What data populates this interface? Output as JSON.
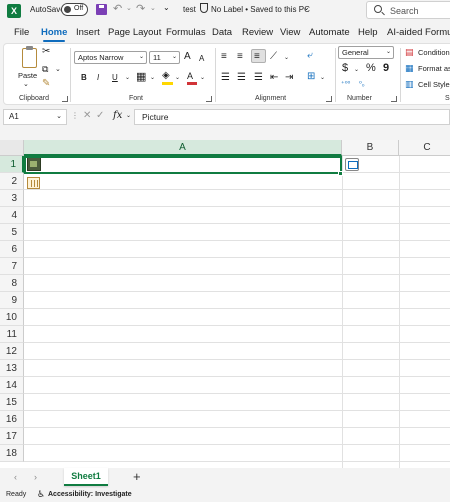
{
  "title_bar": {
    "app_icon": "excel-logo",
    "autosave_label": "AutoSave",
    "autosave_state": "Off",
    "document_name": "test",
    "sensitivity_label": "No Label • Saved to this PC",
    "search_placeholder": "Search"
  },
  "tabs": [
    "File",
    "Home",
    "Insert",
    "Page Layout",
    "Formulas",
    "Data",
    "Review",
    "View",
    "Automate",
    "Help",
    "AI-aided Formula"
  ],
  "active_tab": "Home",
  "ribbon": {
    "clipboard": {
      "label": "Clipboard",
      "paste_label": "Paste"
    },
    "font": {
      "label": "Font",
      "font_name": "Aptos Narrow",
      "font_size": "11",
      "bold": "B",
      "italic": "I",
      "underline": "U",
      "grow": "A",
      "shrink": "A",
      "font_color_letter": "A",
      "fill_color": "#ffd700",
      "font_color": "#d13438"
    },
    "alignment": {
      "label": "Alignment"
    },
    "number": {
      "label": "Number",
      "format": "General",
      "currency": "$",
      "percent": "%",
      "comma": "9"
    },
    "styles": {
      "conditional": "Condition",
      "format_as": "Format as",
      "cell_styles": "Cell Styles"
    },
    "partial_label": "S"
  },
  "formula_bar": {
    "name_box": "A1",
    "fx": "fx",
    "content": "Picture"
  },
  "grid": {
    "columns": [
      "A",
      "B",
      "C"
    ],
    "rows": [
      "1",
      "2",
      "3",
      "4",
      "5",
      "6",
      "7",
      "8",
      "9",
      "10",
      "11",
      "12",
      "13",
      "14",
      "15",
      "16",
      "17",
      "18"
    ],
    "selected_cell": "A1"
  },
  "sheets": {
    "active": "Sheet1",
    "add": "+"
  },
  "status_bar": {
    "ready": "Ready",
    "accessibility": "Accessibility: Investigate"
  }
}
